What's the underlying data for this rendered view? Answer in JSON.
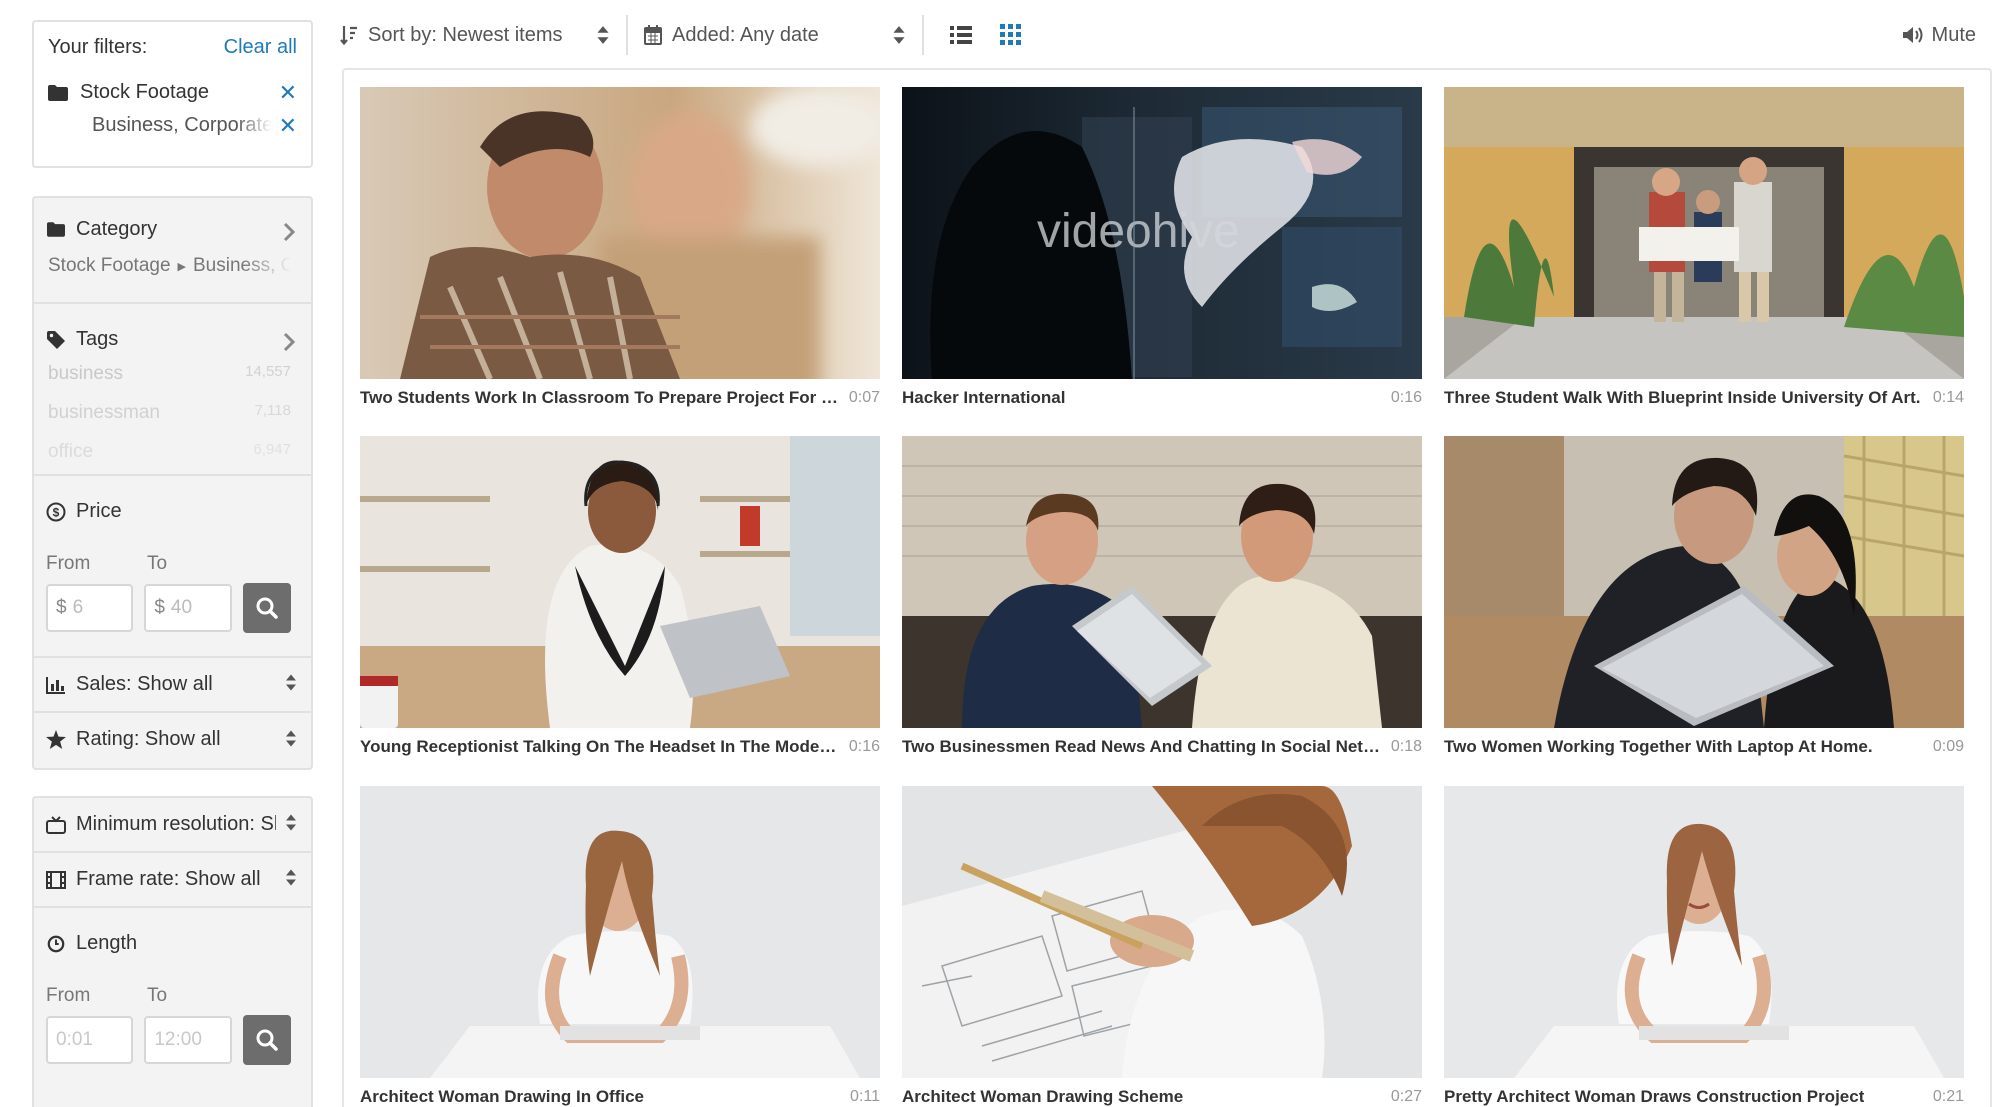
{
  "filters": {
    "heading": "Your filters:",
    "clear_all": "Clear all",
    "items": [
      {
        "label": "Stock Footage",
        "icon": "folder-icon"
      },
      {
        "label": "Business, Corporate"
      }
    ]
  },
  "category": {
    "label": "Category",
    "path": [
      "Stock Footage",
      "Business, Corporate"
    ]
  },
  "tags": {
    "label": "Tags",
    "items": [
      {
        "name": "business",
        "count": "14,557"
      },
      {
        "name": "businessman",
        "count": "7,118"
      },
      {
        "name": "office",
        "count": "6,947"
      }
    ]
  },
  "price": {
    "label": "Price",
    "from_label": "From",
    "to_label": "To",
    "currency": "$",
    "from_placeholder": "6",
    "to_placeholder": "40"
  },
  "selects_a": {
    "sales": "Sales: Show all",
    "rating": "Rating: Show all"
  },
  "selects_b": {
    "resolution": "Minimum resolution: Show all",
    "frame_rate": "Frame rate: Show all"
  },
  "length": {
    "label": "Length",
    "from_label": "From",
    "to_label": "To",
    "from_placeholder": "0:01",
    "to_placeholder": "12:00"
  },
  "toolbar": {
    "sort": "Sort by: Newest items",
    "added": "Added: Any date",
    "mute": "Mute",
    "active_view": "grid",
    "accent": "#1f7ab8"
  },
  "items": [
    {
      "title": "Two Students Work In Classroom To Prepare Project For Lesson",
      "duration": "0:07"
    },
    {
      "title": "Hacker International",
      "duration": "0:16",
      "watermark": "videohive"
    },
    {
      "title": "Three Student Walk With Blueprint Inside University Of Art.",
      "duration": "0:14"
    },
    {
      "title": "Young Receptionist Talking On The Headset In The Modern Office",
      "duration": "0:16"
    },
    {
      "title": "Two Businessmen Read News And Chatting In Social Networks",
      "duration": "0:18"
    },
    {
      "title": "Two Women Working Together With Laptop At Home.",
      "duration": "0:09"
    },
    {
      "title": "Architect Woman Drawing In Office",
      "duration": "0:11"
    },
    {
      "title": "Architect Woman Drawing Scheme",
      "duration": "0:27"
    },
    {
      "title": "Pretty Architect Woman Draws Construction Project",
      "duration": "0:21"
    }
  ]
}
